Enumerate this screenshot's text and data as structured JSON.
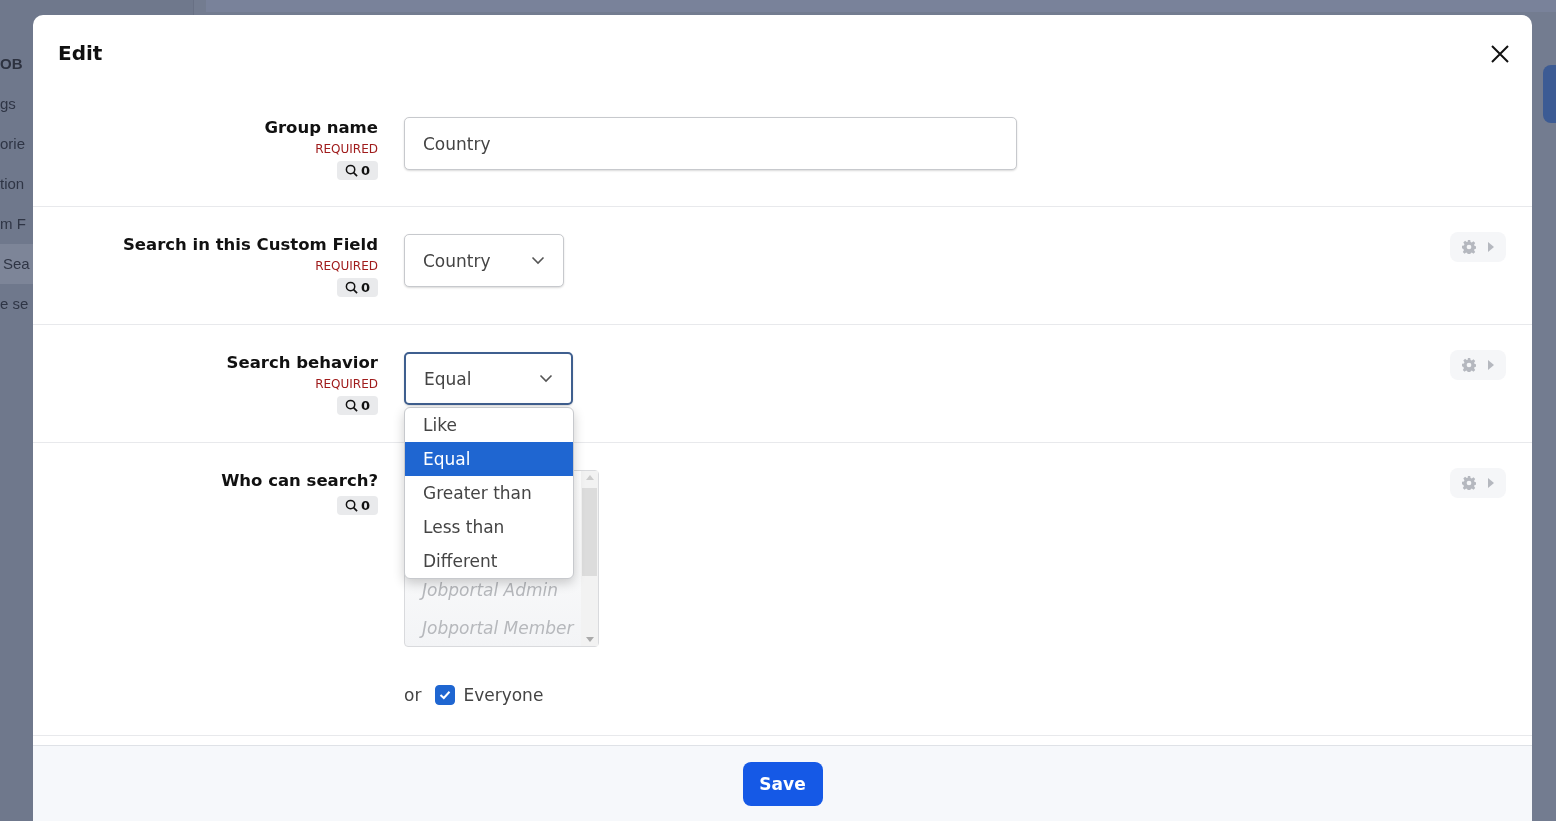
{
  "background": {
    "sidebar_items": [
      {
        "kind": "heading",
        "label": "OB",
        "selected": false
      },
      {
        "kind": "item",
        "label": "gs",
        "selected": false
      },
      {
        "kind": "item",
        "label": "orie",
        "selected": false
      },
      {
        "kind": "item",
        "label": "tion",
        "selected": false
      },
      {
        "kind": "item",
        "label": "m F",
        "selected": false
      },
      {
        "kind": "item",
        "label": "Sea",
        "selected": true
      },
      {
        "kind": "item",
        "label": "e se",
        "selected": false
      }
    ]
  },
  "dialog": {
    "title": "Edit"
  },
  "fields": [
    {
      "kind": "text",
      "label": "Group name",
      "required_note": "REQUIRED",
      "search_count": "0",
      "value": "Country",
      "settings": false
    },
    {
      "kind": "select",
      "label": "Search in this Custom Field",
      "required_note": "REQUIRED",
      "search_count": "0",
      "value": "Country",
      "settings": true,
      "expanded": false
    },
    {
      "kind": "select",
      "label": "Search behavior",
      "required_note": "REQUIRED",
      "search_count": "0",
      "value": "Equal",
      "settings": true,
      "expanded": true,
      "options": [
        {
          "label": "Like",
          "selected": false
        },
        {
          "label": "Equal",
          "selected": true
        },
        {
          "label": "Greater than",
          "selected": false
        },
        {
          "label": "Less than",
          "selected": false
        },
        {
          "label": "Different",
          "selected": false
        }
      ]
    },
    {
      "kind": "listbox",
      "label": "Who can search?",
      "search_count": "0",
      "settings": true,
      "items": [
        {
          "label": "Jobportal Admin",
          "disabled": true
        },
        {
          "label": "Jobportal Member",
          "disabled": true
        }
      ],
      "connector": "or",
      "checkbox": {
        "label": "Everyone",
        "checked": true
      }
    }
  ],
  "save_button": "Save"
}
